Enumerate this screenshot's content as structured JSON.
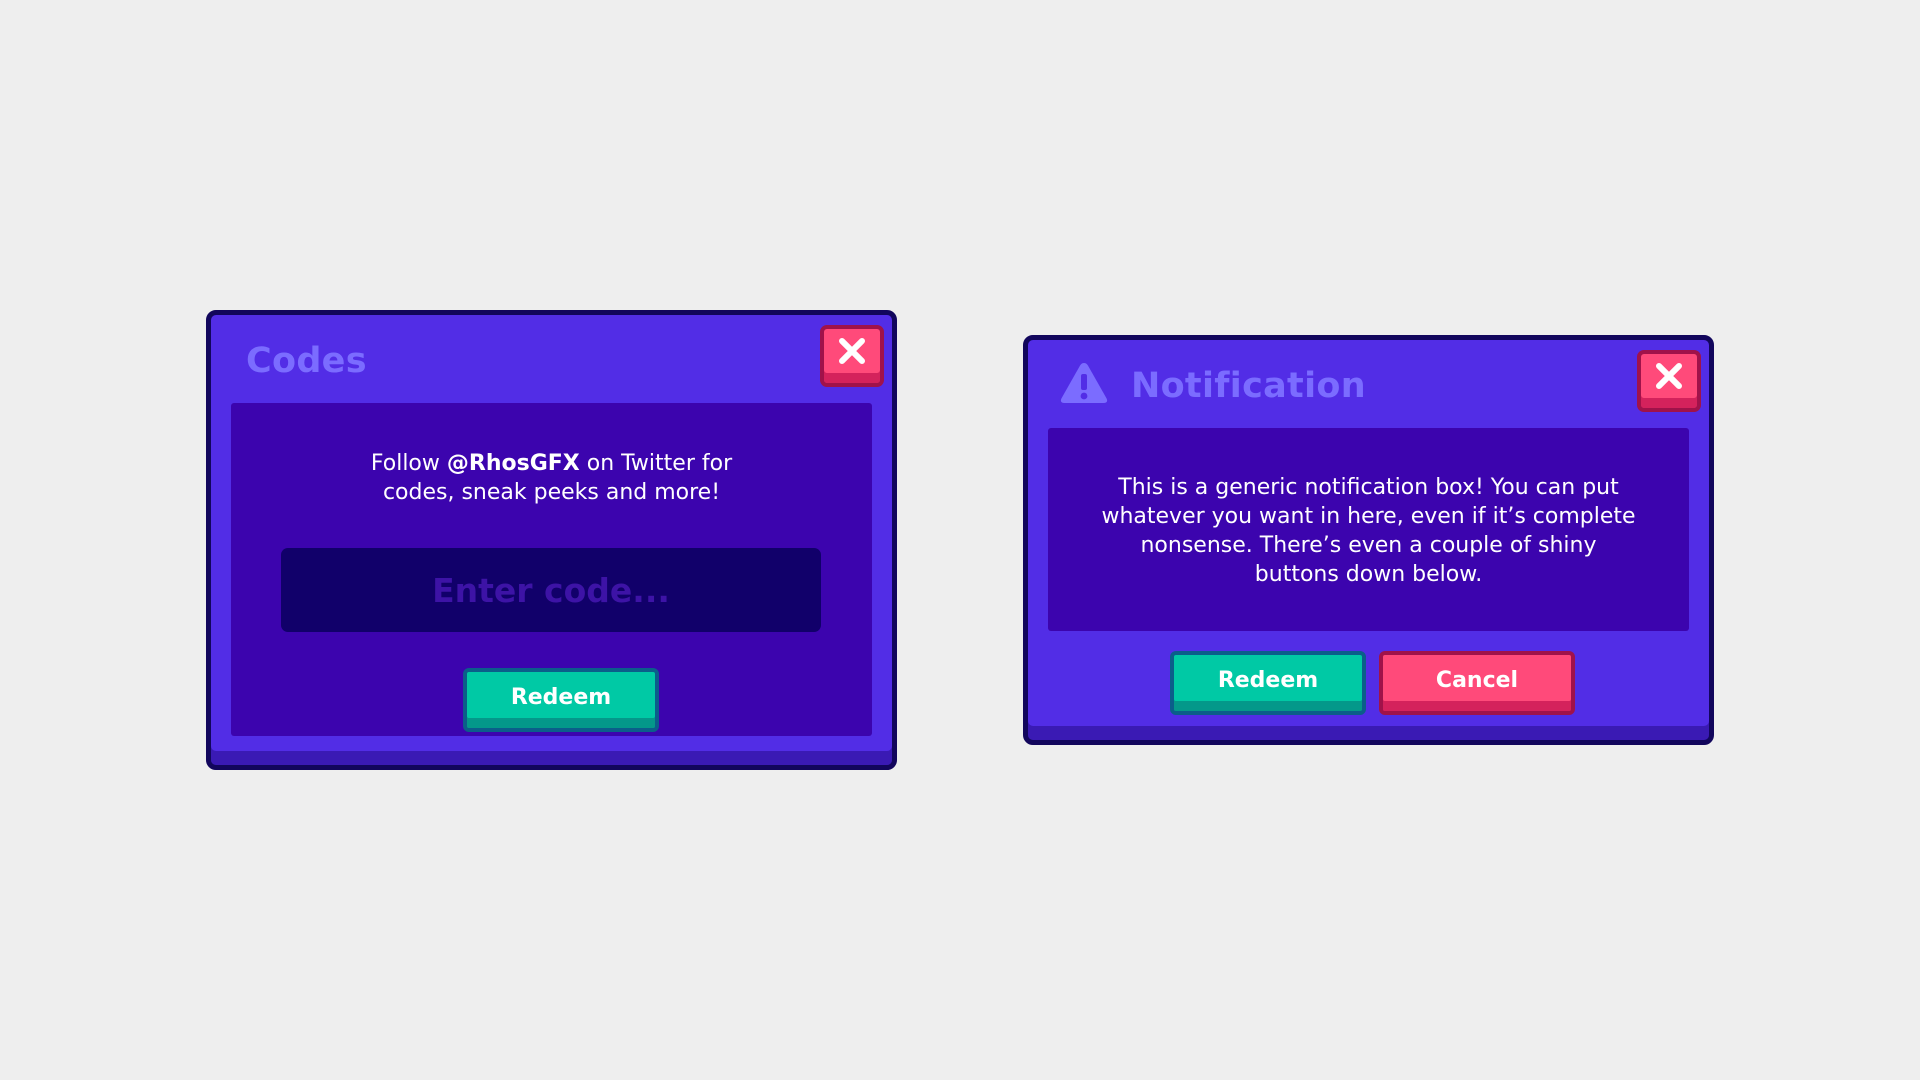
{
  "codes_panel": {
    "title": "Codes",
    "message_prefix": "Follow ",
    "message_handle": "@RhosGFX",
    "message_suffix": " on Twitter for",
    "message_line2": "codes, sneak peeks and more!",
    "code_input": {
      "value": "",
      "placeholder": "Enter code..."
    },
    "redeem_label": "Redeem",
    "close_icon": "close-icon"
  },
  "notification_panel": {
    "title": "Notification",
    "title_icon": "warning-icon",
    "message": "This is a generic notification box! You can put whatever you want in here, even if it’s complete nonsense. There’s even a couple of shiny buttons down below.",
    "redeem_label": "Redeem",
    "cancel_label": "Cancel",
    "close_icon": "close-icon"
  },
  "colors": {
    "background": "#eeeeee",
    "panel": "#522de6",
    "panel_border": "#12065c",
    "content": "#3c04ae",
    "title": "#7b6cff",
    "input": "#11006a",
    "green": "#00c9a5",
    "red": "#ff4a7a"
  }
}
